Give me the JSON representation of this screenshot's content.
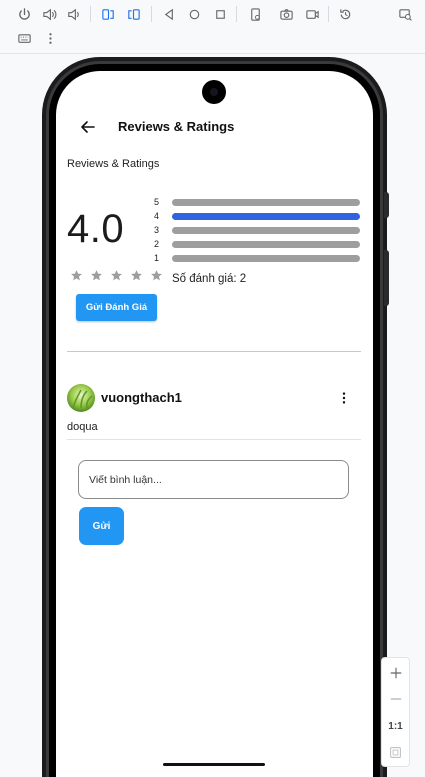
{
  "toolbar": {
    "buttons": [
      "power-icon",
      "volume-up-icon",
      "volume-down-icon",
      "rotate-left-icon",
      "rotate-right-icon",
      "back-icon",
      "home-icon",
      "overview-icon",
      "fold-icon",
      "camera-icon",
      "screenrecord-icon",
      "reset-icon",
      "zoom-screen-icon",
      "keyboard-icon",
      "more-vert-icon"
    ]
  },
  "app": {
    "title": "Reviews & Ratings",
    "section_title": "Reviews & Ratings",
    "average_rating": "4.0",
    "stars_filled": 0,
    "stars_total": 5,
    "rating_distribution": [
      {
        "label": "5",
        "fraction": 0.0
      },
      {
        "label": "4",
        "fraction": 1.0
      },
      {
        "label": "3",
        "fraction": 0.0
      },
      {
        "label": "2",
        "fraction": 0.0
      },
      {
        "label": "1",
        "fraction": 0.0
      }
    ],
    "review_count_text": "Số đánh giá: 2",
    "submit_review_label": "Gửi Đánh Giá",
    "review": {
      "username": "vuongthach1",
      "text": "doqua"
    },
    "comment_placeholder": "Viết bình luận...",
    "send_label": "Gửi"
  },
  "zoom": {
    "one_to_one_label": "1:1"
  },
  "colors": {
    "accent": "#2196f3",
    "bar_fill": "#2f63e0",
    "bar_track": "#9e9e9e",
    "star_empty": "#9e9e9e"
  }
}
